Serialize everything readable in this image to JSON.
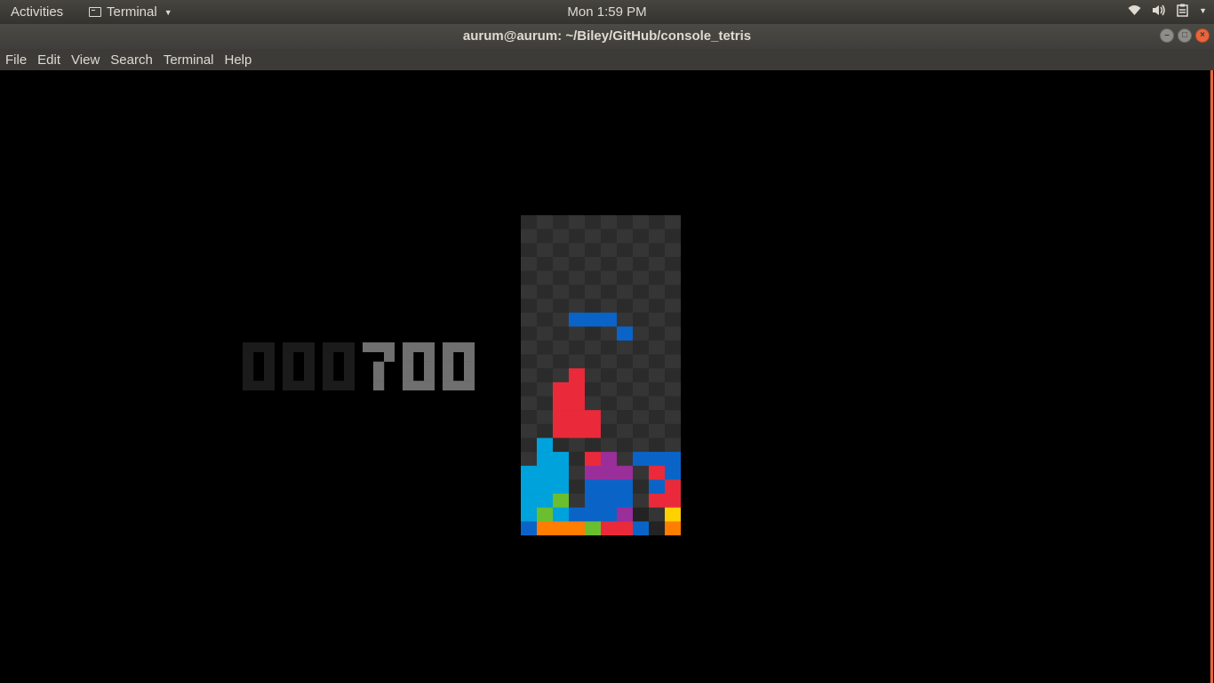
{
  "topbar": {
    "activities_label": "Activities",
    "app_menu_label": "Terminal",
    "clock": "Mon  1:59 PM",
    "status_icons": [
      "wifi-icon",
      "volume-icon",
      "clipboard-icon",
      "system-menu-caret-icon"
    ]
  },
  "window": {
    "title": "aurum@aurum: ~/Biley/GitHub/console_tetris",
    "buttons": [
      "minimize",
      "maximize",
      "close"
    ]
  },
  "menubar": {
    "items": [
      "File",
      "Edit",
      "View",
      "Search",
      "Terminal",
      "Help"
    ]
  },
  "game": {
    "score": "000700",
    "score_leading_zeros": 3,
    "colors": {
      "board_dark": "#2b2b2b",
      "board_light": "#353535",
      "digit_dim": "#1b1b1b",
      "digit_lit": "#6f6f6f",
      "I": "#00a2dc",
      "J": "#0a64c8",
      "L": "#ff7d00",
      "O": "#ffd100",
      "S": "#6bbf2e",
      "T": "#9a2e9a",
      "Z": "#ea2a3a",
      "E": "#232323"
    },
    "board": {
      "cols": 10,
      "rows": [
        "..........",
        "..........",
        "..........",
        "..........",
        "..........",
        "..........",
        "..........",
        "...JJJ....",
        "......J...",
        "..........",
        "..........",
        "...Z......",
        "..ZZ......",
        "..ZZ......",
        "..ZZZ.....",
        "..ZZZ.....",
        ".I........",
        ".II.ZT.JJJ",
        "III.TTT.ZJ",
        "III.JJJ.JZ",
        "IIS.JJJ.ZZ",
        "ISIJJJTE.OO",
        "JLLLSZZJEL"
      ]
    }
  }
}
